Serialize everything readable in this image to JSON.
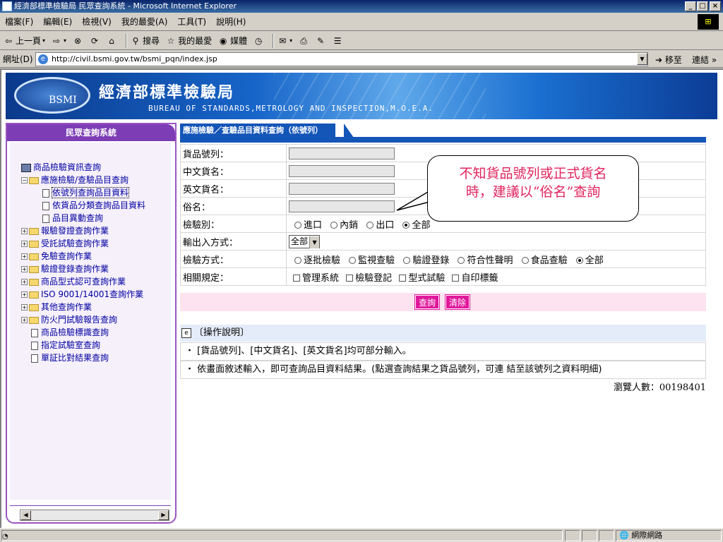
{
  "window": {
    "title": "經濟部標準檢驗局 民眾查詢系統 - Microsoft Internet Explorer"
  },
  "menu": [
    "檔案(F)",
    "編輯(E)",
    "檢視(V)",
    "我的最愛(A)",
    "工具(T)",
    "說明(H)"
  ],
  "toolbar": {
    "back": "上一頁",
    "search": "搜尋",
    "favorites": "我的最愛",
    "media": "媒體"
  },
  "address": {
    "label": "網址(D)",
    "url": "http://civil.bsmi.gov.tw/bsmi_pqn/index.jsp",
    "go": "移至",
    "links": "連結 »"
  },
  "banner": {
    "logo_text": "BSMI",
    "title_cn": "經濟部標準檢驗局",
    "title_en": "BUREAU OF STANDARDS,METROLOGY AND INSPECTION,M.O.E.A."
  },
  "sidebar": {
    "header": "民眾查詢系統",
    "root": "商品檢驗資訊查詢",
    "open_folder": "應施檢驗/查驗品目查詢",
    "sub_items": [
      "依號列查詢品目資料",
      "依貨品分類查詢品目資料",
      "品目異動查詢"
    ],
    "folders": [
      "報驗發證查詢作業",
      "受託試驗查詢作業",
      "免驗查詢作業",
      "驗證登錄查詢作業",
      "商品型式認可查詢作業",
      "ISO 9001/14001查詢作業",
      "其他查詢作業",
      "防火門試驗報告查詢"
    ],
    "docs": [
      "商品檢驗標識查詢",
      "指定試驗室查詢",
      "單証比對結果查詢"
    ]
  },
  "main": {
    "tab_title": "應施檢驗／查驗品目資料查詢（依號列）",
    "fields": {
      "goods_no": "貨品號列：",
      "cn_name": "中文貨名：",
      "en_name": "英文貨名：",
      "common_name": "俗名："
    },
    "inspection_type": {
      "label": "檢驗別：",
      "options": [
        "進口",
        "內銷",
        "出口",
        "全部"
      ],
      "selected": "全部"
    },
    "io_method": {
      "label": "輸出入方式：",
      "value": "全部"
    },
    "inspection_method": {
      "label": "檢驗方式：",
      "options": [
        "逐批檢驗",
        "監視查驗",
        "驗證登錄",
        "符合性聲明",
        "食品查驗",
        "全部"
      ],
      "selected": "全部"
    },
    "regulations": {
      "label": "相關規定：",
      "options": [
        "管理系統",
        "檢驗登記",
        "型式試驗",
        "自印標籤"
      ]
    },
    "buttons": {
      "query": "查詢",
      "clear": "清除"
    },
    "help": {
      "title": "〔操作說明〕",
      "lines": [
        "[貨品號列]、[中文貨名]、[英文貨名]均可部分輸入。",
        "依畫面敘述輸入，即可查詢品目資料結果。(點選查詢結果之貨品號列，可連 結至該號列之資料明細)"
      ]
    },
    "views": "瀏覽人數：00198401"
  },
  "callout": {
    "line1": "不知貨品號列或正式貨名",
    "line2": "時，建議以“俗名”查詢"
  },
  "status": {
    "zone": "網際網路"
  },
  "colors": {
    "sidebar_accent": "#7d3eb5",
    "tab_blue": "#1455b8",
    "button_pink": "#e0179b",
    "callout_text": "#e0245e"
  }
}
